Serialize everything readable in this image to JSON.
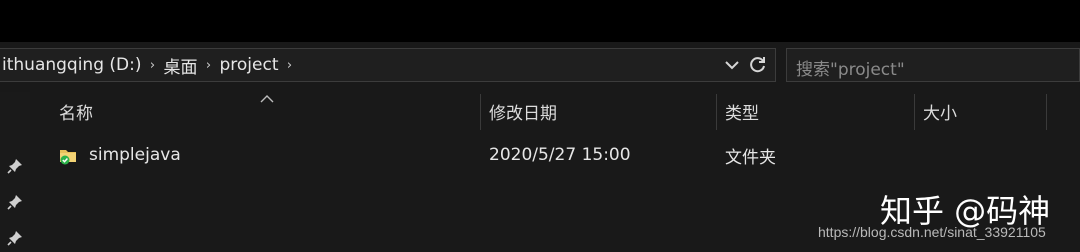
{
  "address": {
    "crumbs": [
      "ithuangqing (D:)",
      "桌面",
      "project"
    ]
  },
  "search": {
    "placeholder": "搜索\"project\""
  },
  "columns": {
    "name": "名称",
    "modified": "修改日期",
    "type": "类型",
    "size": "大小"
  },
  "files": [
    {
      "name": "simplejava",
      "modified": "2020/5/27 15:00",
      "type": "文件夹",
      "size": ""
    }
  ],
  "watermark": {
    "text": "知乎 @码神",
    "url": "https://blog.csdn.net/sinat_33921105"
  },
  "icons": {
    "sep": "chevron-right-icon",
    "dropdown": "chevron-down-icon",
    "refresh": "refresh-icon",
    "pin": "pin-icon",
    "folder": "shared-folder-icon"
  },
  "colors": {
    "background": "#191919",
    "accent_check": "#2db24a",
    "folder": "#e8c15a"
  }
}
